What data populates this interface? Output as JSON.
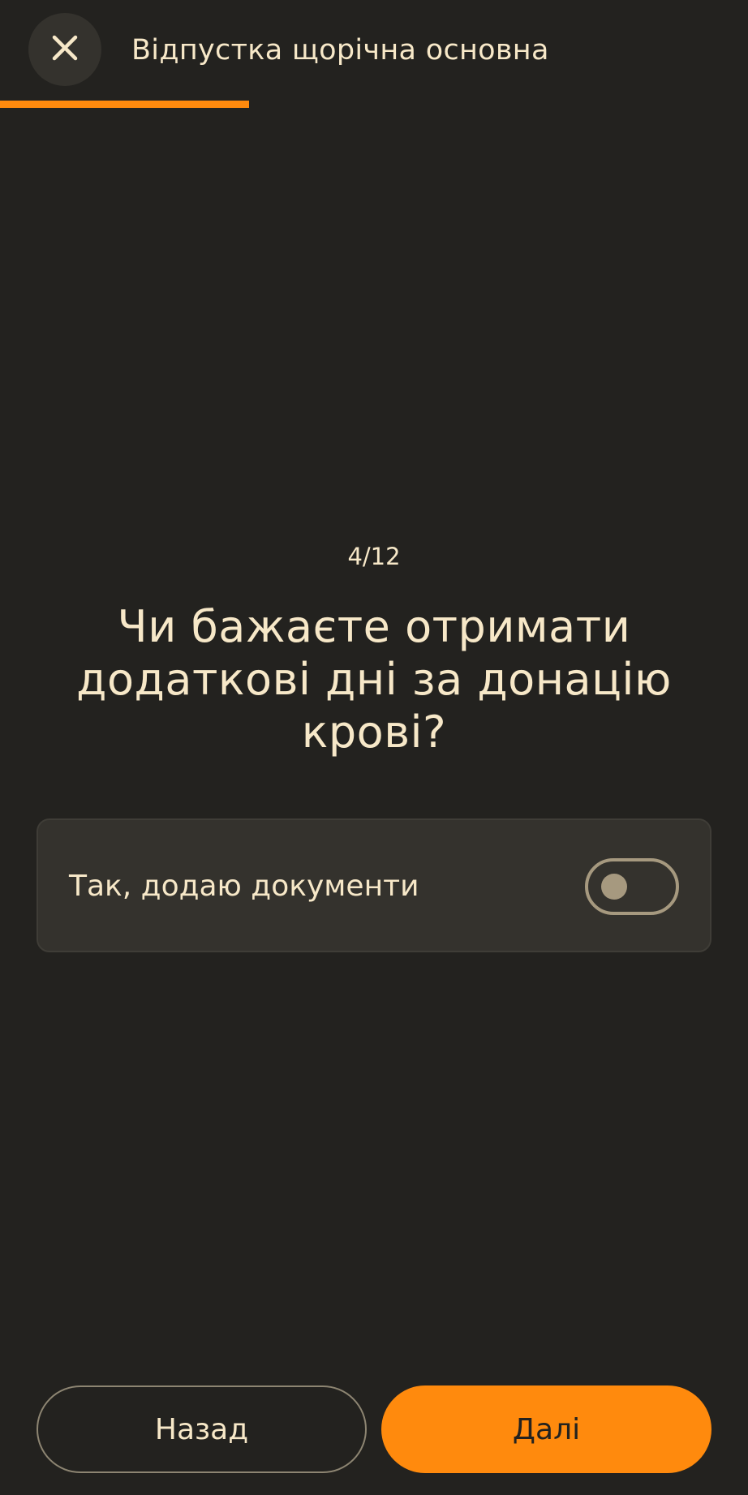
{
  "header": {
    "close_icon": "close-icon",
    "title": "Відпустка щорічна основна"
  },
  "progress": {
    "current": 4,
    "total": 12,
    "fraction": 0.333,
    "color": "#ff8a0d"
  },
  "step": {
    "label": "4/12"
  },
  "question": {
    "text": "Чи бажаєте отримати додаткові дні за донацію крові?"
  },
  "option": {
    "label": "Так, додаю документи",
    "toggle_on": false
  },
  "footer": {
    "back_label": "Назад",
    "next_label": "Далі"
  },
  "colors": {
    "background": "#23221f",
    "accent": "#ff8a0d",
    "text": "#f7e8c8"
  }
}
